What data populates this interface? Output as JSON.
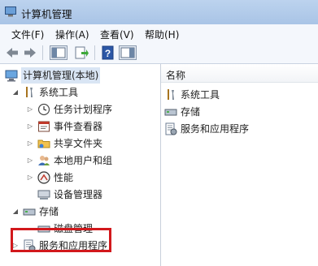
{
  "window": {
    "title": "计算机管理"
  },
  "menu": [
    "文件(F)",
    "操作(A)",
    "查看(V)",
    "帮助(H)"
  ],
  "toolbar": {
    "back_icon": "back-arrow-icon",
    "forward_icon": "forward-arrow-icon",
    "show_tree_icon": "console-tree-icon",
    "export_icon": "export-list-icon",
    "help_icon": "help-icon",
    "show_action_pane_icon": "action-pane-icon"
  },
  "tree": {
    "root": "计算机管理(本地)",
    "system_tools": "系统工具",
    "system_tools_children": [
      "任务计划程序",
      "事件查看器",
      "共享文件夹",
      "本地用户和组",
      "性能",
      "设备管理器"
    ],
    "storage": "存储",
    "storage_children": [
      "磁盘管理"
    ],
    "services": "服务和应用程序"
  },
  "list": {
    "column": "名称",
    "items": [
      "系统工具",
      "存储",
      "服务和应用程序"
    ]
  },
  "colors": {
    "highlight": "#d2181c",
    "titlebar": "#b7cfec"
  }
}
